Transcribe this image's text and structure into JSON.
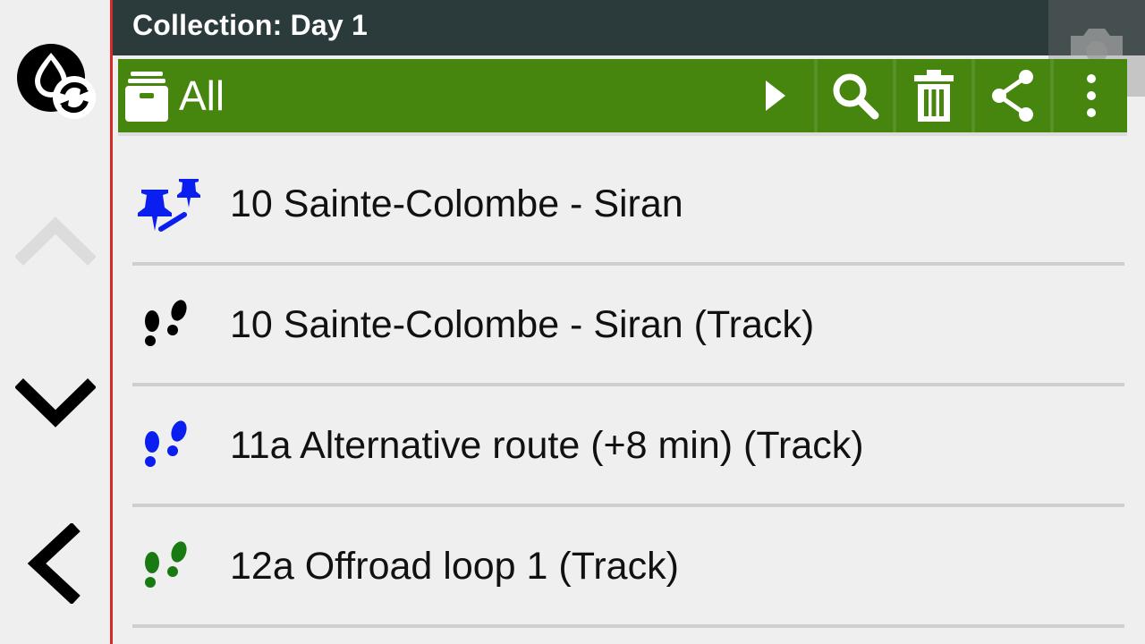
{
  "titlebar": {
    "title": "Collection: Day 1"
  },
  "rail": {
    "buttons": [
      {
        "icon": "map-sync-icon"
      },
      {
        "icon": "chevron-up-icon",
        "disabled": true
      },
      {
        "icon": "chevron-down-icon"
      },
      {
        "icon": "back-arrow-icon"
      }
    ]
  },
  "toolbar": {
    "filter_label": "All",
    "filter_icon": "archive-box-icon",
    "actions": [
      "play-icon",
      "search-icon",
      "trash-icon",
      "share-icon",
      "more-vert-icon"
    ]
  },
  "items": [
    {
      "label": "10 Sainte-Colombe - Siran",
      "icon": "route-pins-icon",
      "color": "#0a1ef0"
    },
    {
      "label": "10 Sainte-Colombe - Siran (Track)",
      "icon": "footprints-icon",
      "color": "#000000"
    },
    {
      "label": "11a Alternative route (+8 min) (Track)",
      "icon": "footprints-icon",
      "color": "#0a1ef0"
    },
    {
      "label": "12a Offroad loop 1 (Track)",
      "icon": "footprints-icon",
      "color": "#1a7a12"
    }
  ],
  "colors": {
    "toolbar_bg": "#46860f",
    "titlebar_bg": "#2b3a3a",
    "rail_divider": "#d62a2a",
    "background": "#efefef"
  }
}
